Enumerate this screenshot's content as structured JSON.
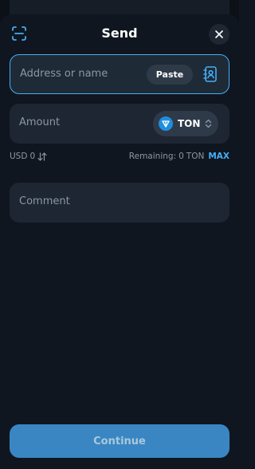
{
  "header": {
    "title": "Send"
  },
  "address": {
    "placeholder": "Address or name",
    "paste_label": "Paste"
  },
  "amount": {
    "placeholder": "Amount",
    "token": "TON"
  },
  "info": {
    "usd_label": "USD",
    "usd_value": "0",
    "remaining_label": "Remaining:",
    "remaining_value": "0",
    "remaining_unit": "TON",
    "max_label": "MAX"
  },
  "comment": {
    "placeholder": "Comment"
  },
  "footer": {
    "continue_label": "Continue"
  },
  "colors": {
    "accent": "#45aef5",
    "background": "#10161f",
    "field": "#1d2632",
    "button": "#3a86c2"
  },
  "icons": [
    "scan-icon",
    "close-icon",
    "contacts-icon",
    "ton-logo-icon",
    "chevron-updown-icon",
    "swap-arrows-icon"
  ]
}
